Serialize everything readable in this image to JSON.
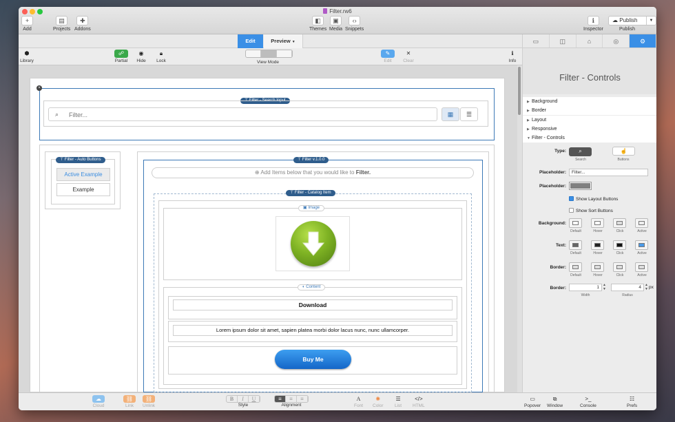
{
  "window": {
    "title": "Filter.rw6"
  },
  "toolbar": {
    "add": "Add",
    "projects": "Projects",
    "addons": "Addons",
    "themes": "Themes",
    "media": "Media",
    "snippets": "Snippets",
    "inspector": "Inspector",
    "publish_button": "Publish",
    "publish": "Publish"
  },
  "modebar": {
    "edit": "Edit",
    "preview": "Preview"
  },
  "tools": {
    "library": "Library",
    "partial": "Partial",
    "hide": "Hide",
    "lock": "Lock",
    "view_mode": "View Mode",
    "edit": "Edit",
    "clear": "Clear",
    "info": "Info"
  },
  "canvas": {
    "search_tag": "Filter - Search Input",
    "search_placeholder": "Filter...",
    "auto_buttons_tag": "Filter - Auto Buttons",
    "active_example": "Active Example",
    "example": "Example",
    "filter_tag": "Filter v.1.0.0",
    "add_items_text": "Add Items below that you would like to",
    "add_items_bold": "Filter.",
    "catalog_tag": "Filter - Catalog Item",
    "image_tag": "Image",
    "content_tag": "Content",
    "download": "Download",
    "lorem": "Lorem ipsum dolor sit amet, sapien platea morbi dolor lacus nunc, nunc ullamcorper.",
    "buy_me": "Buy Me"
  },
  "inspector": {
    "title": "Filter - Controls",
    "sections": [
      "Background",
      "Border",
      "Layout",
      "Responsive",
      "Filter - Controls"
    ],
    "type_label": "Type:",
    "type_search": "Search",
    "type_buttons": "Buttons",
    "placeholder_label": "Placeholder:",
    "placeholder_value": "Filter...",
    "placeholder_color_label": "Placeholder:",
    "show_layout": "Show Layout Buttons",
    "show_layout_checked": true,
    "show_sort": "Show Sort Buttons",
    "show_sort_checked": false,
    "background_label": "Background:",
    "text_label": "Text:",
    "border_label": "Border:",
    "state_labels": [
      "Default",
      "Hover",
      "Click",
      "Active"
    ],
    "border_size_label": "Border:",
    "width_value": "1",
    "radius_value": "4",
    "unit": "px",
    "width_label": "Width",
    "radius_label": "Radius"
  },
  "bottom": {
    "cloud": "Cloud",
    "link": "Link",
    "unlink": "Unlink",
    "bold": "B",
    "italic": "I",
    "underline": "U",
    "style": "Style",
    "alignment": "Alignment",
    "font": "Font",
    "color": "Color",
    "list": "List",
    "html": "HTML",
    "popover": "Popover",
    "window": "Window",
    "console": "Console",
    "prefs": "Prefs"
  },
  "colors": {
    "accent": "#3a8fe6",
    "tag": "#2f5d8c",
    "buy": "#1f7fdc"
  }
}
